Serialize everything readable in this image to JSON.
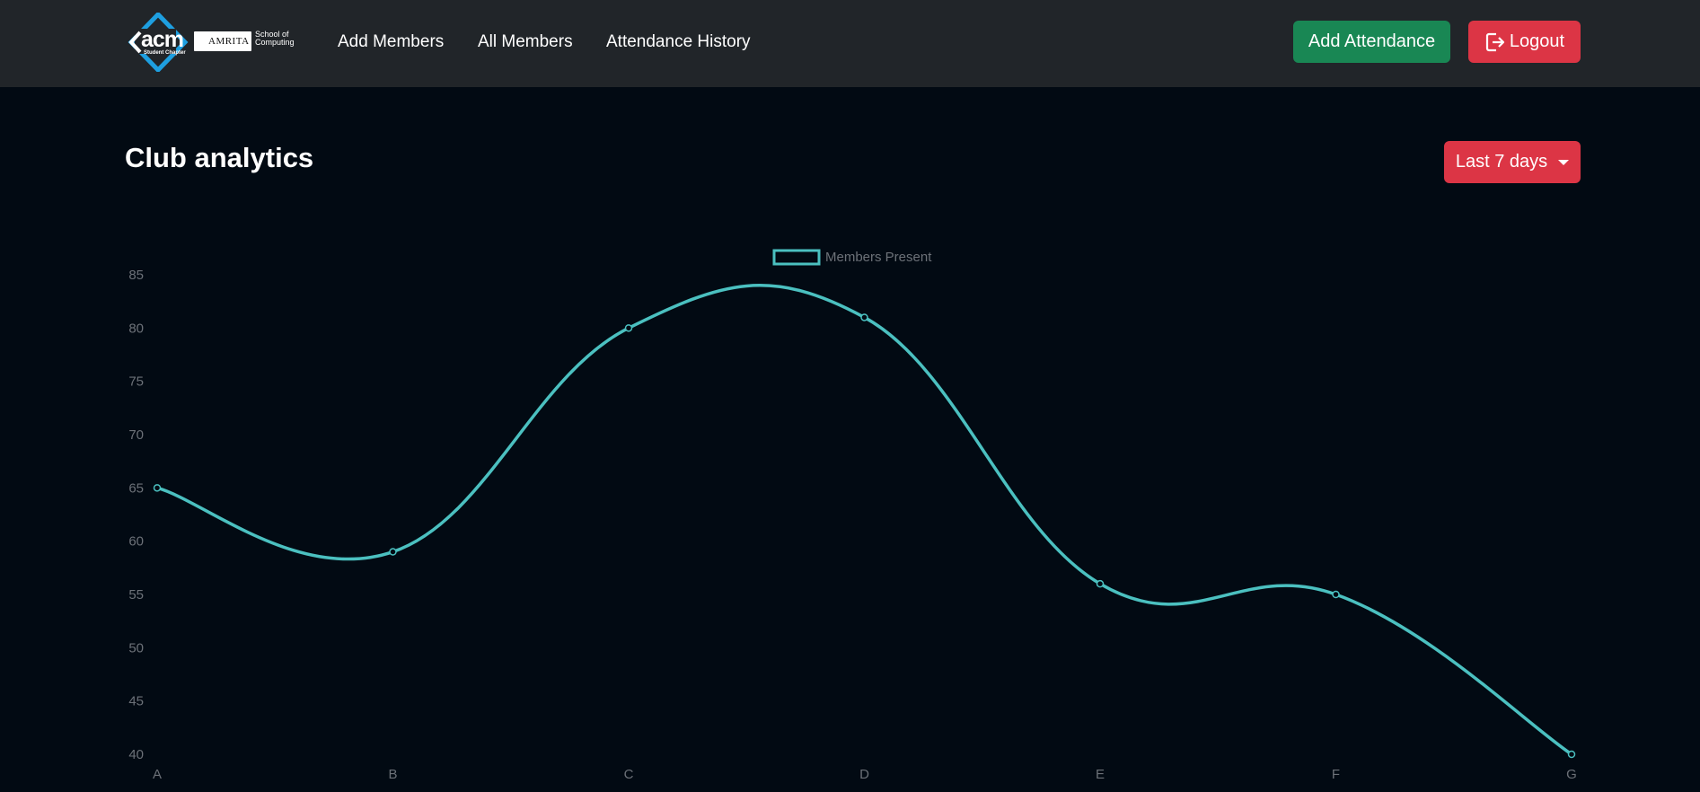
{
  "navbar": {
    "logo": {
      "acm_text": "acm",
      "acm_sub": "Student Chapter",
      "amrita_text": "AMRITA",
      "school_line1": "School of",
      "school_line2": "Computing"
    },
    "links": [
      "Add Members",
      "All Members",
      "Attendance History"
    ],
    "add_attendance_label": "Add Attendance",
    "logout_label": "Logout"
  },
  "main": {
    "title": "Club analytics",
    "range_selector": "Last 7 days"
  },
  "colors": {
    "navbar_bg": "#212529",
    "page_bg": "#020a13",
    "success": "#198754",
    "danger": "#dc3545",
    "series_line": "#4bc0c0",
    "tick_text": "#6c7178"
  },
  "chart_data": {
    "type": "line",
    "categories": [
      "A",
      "B",
      "C",
      "D",
      "E",
      "F",
      "G"
    ],
    "series": [
      {
        "name": "Members Present",
        "values": [
          65,
          59,
          80,
          81,
          56,
          55,
          40
        ]
      }
    ],
    "ylim": [
      40,
      85
    ],
    "yticks": [
      40,
      45,
      50,
      55,
      60,
      65,
      70,
      75,
      80,
      85
    ],
    "legend": "top-center",
    "grid": false,
    "smooth": true
  }
}
